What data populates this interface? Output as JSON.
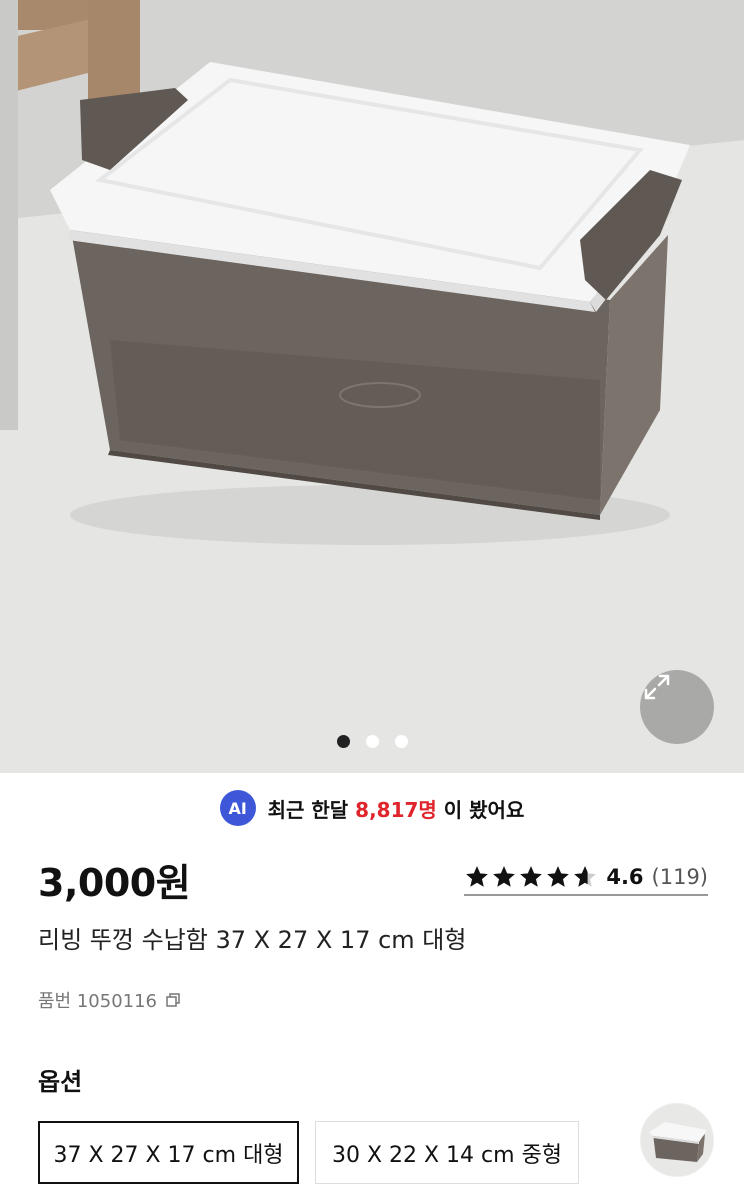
{
  "gallery": {
    "current_slide": 1,
    "total_slides": 3
  },
  "icons": {
    "expand": "expand-arrows-icon",
    "copy": "copy-icon",
    "star": "star-icon"
  },
  "ai_banner": {
    "badge": "AI",
    "prefix": "최근 한달",
    "count": "8,817명",
    "suffix": "이 봤어요",
    "count_color": "#e0242b",
    "badge_color": "#3e57d9"
  },
  "product": {
    "price": "3,000원",
    "rating_value": "4.6",
    "rating_count": "(119)",
    "rating_stars": 4.6,
    "title": "리빙 뚜껑 수납함 37 X 27 X 17 cm 대형",
    "sku": "품번 1050116"
  },
  "options": {
    "heading": "옵션",
    "items": [
      {
        "label": "37 X 27 X 17 cm 대형",
        "selected": true
      },
      {
        "label": "30 X 22 X 14 cm 중형",
        "selected": false
      }
    ]
  }
}
